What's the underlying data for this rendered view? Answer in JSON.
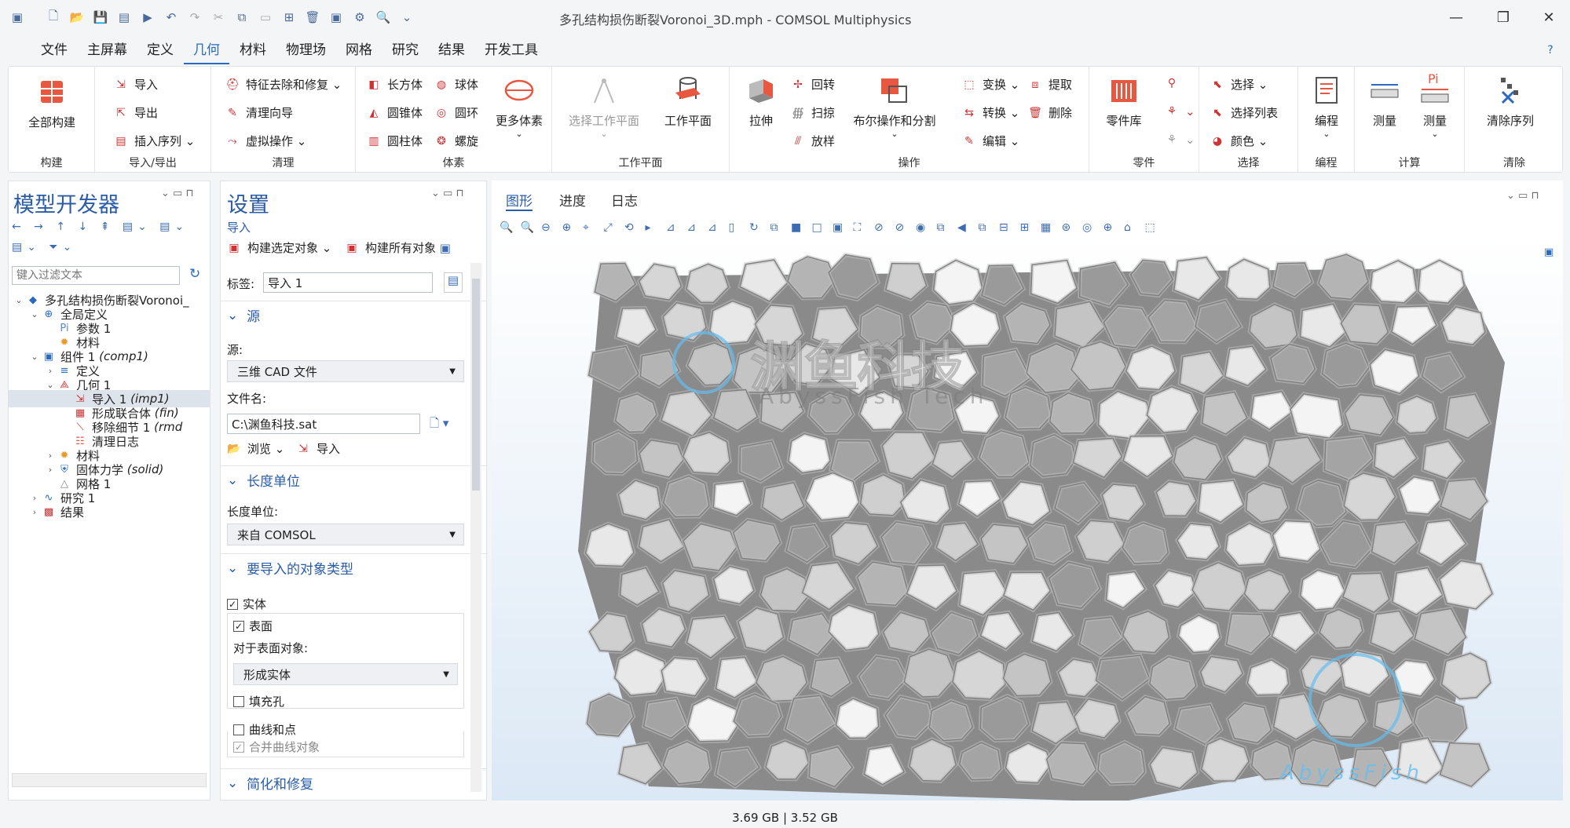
{
  "window": {
    "title": "多孔结构损伤断裂Voronoi_3D.mph - COMSOL Multiphysics"
  },
  "menubar": [
    "文件",
    "主屏幕",
    "定义",
    "几何",
    "材料",
    "物理场",
    "网格",
    "研究",
    "结果",
    "开发工具"
  ],
  "menubar_active": "几何",
  "ribbon": {
    "build": {
      "all": "全部构建",
      "group": "构建"
    },
    "io": {
      "import": "导入",
      "export": "导出",
      "insert_seq": "插入序列",
      "group": "导入/导出"
    },
    "cleanup": {
      "defeature": "特征去除和修复",
      "wizard": "清理向导",
      "virtual": "虚拟操作",
      "group": "清理"
    },
    "primitives": {
      "block": "长方体",
      "sphere": "球体",
      "cone": "圆锥体",
      "torus": "圆环",
      "cylinder": "圆柱体",
      "helix": "螺旋",
      "more": "更多体素",
      "group": "体素"
    },
    "workplane": {
      "select": "选择工作平面",
      "plane": "工作平面",
      "group": "工作平面"
    },
    "operations": {
      "extrude": "拉伸",
      "revolve": "回转",
      "sweep": "扫掠",
      "loft": "放样",
      "boolean": "布尔操作和分割",
      "transform": "变换",
      "convert": "转换",
      "edit": "编辑",
      "extract": "提取",
      "delete": "删除",
      "group": "操作"
    },
    "parts": {
      "library": "零件库",
      "group": "零件"
    },
    "selections": {
      "select": "选择",
      "list": "选择列表",
      "color": "颜色",
      "group": "选择"
    },
    "programming": {
      "program": "编程",
      "group": "编程"
    },
    "measure": {
      "measure1": "测量",
      "measure2": "测量",
      "group": "计算"
    },
    "clear": {
      "clear_seq": "清除序列",
      "group": "清除"
    }
  },
  "model_builder": {
    "title": "模型开发器",
    "filter_placeholder": "键入过滤文本",
    "tree": [
      {
        "label": "多孔结构损伤断裂Voronoi_",
        "tag": ""
      },
      {
        "label": "全局定义",
        "tag": ""
      },
      {
        "label": "参数 1",
        "tag": ""
      },
      {
        "label": "材料",
        "tag": ""
      },
      {
        "label": "组件 1",
        "tag": "(comp1)"
      },
      {
        "label": "定义",
        "tag": ""
      },
      {
        "label": "几何 1",
        "tag": ""
      },
      {
        "label": "导入 1",
        "tag": "(imp1)"
      },
      {
        "label": "形成联合体",
        "tag": "(fin)"
      },
      {
        "label": "移除细节 1",
        "tag": "(rmd"
      },
      {
        "label": "清理日志",
        "tag": ""
      },
      {
        "label": "材料",
        "tag": ""
      },
      {
        "label": "固体力学",
        "tag": "(solid)"
      },
      {
        "label": "网格 1",
        "tag": ""
      },
      {
        "label": "研究 1",
        "tag": ""
      },
      {
        "label": "结果",
        "tag": ""
      }
    ]
  },
  "settings": {
    "title": "设置",
    "subtitle": "导入",
    "build_selected": "构建选定对象",
    "build_all": "构建所有对象",
    "label_caption": "标签:",
    "label_value": "导入 1",
    "source_section": "源",
    "source_caption": "源:",
    "source_value": "三维 CAD 文件",
    "filename_caption": "文件名:",
    "filename_value": "C:\\渊鱼科技.sat",
    "browse": "浏览",
    "import": "导入",
    "length_section": "长度单位",
    "length_caption": "长度单位:",
    "length_value": "来自 COMSOL",
    "objtype_section": "要导入的对象类型",
    "solid": "实体",
    "surface": "表面",
    "surface_obj_caption": "对于表面对象:",
    "surface_obj_value": "形成实体",
    "fill_holes": "填充孔",
    "curves_points": "曲线和点",
    "merge_curves": "合并曲线对象",
    "simplify_section": "简化和修复"
  },
  "graphics": {
    "tabs": [
      "图形",
      "进度",
      "日志"
    ],
    "watermark_cn": "渊鱼科技",
    "watermark_en": "AbyssFish Tech",
    "watermark_small": "AbyssFish"
  },
  "status": {
    "memory": "3.69 GB | 3.52 GB"
  },
  "colors": {
    "accent": "#2a5ca8",
    "viewport_top": "#ffffff",
    "viewport_bottom": "#cfe0f2"
  }
}
